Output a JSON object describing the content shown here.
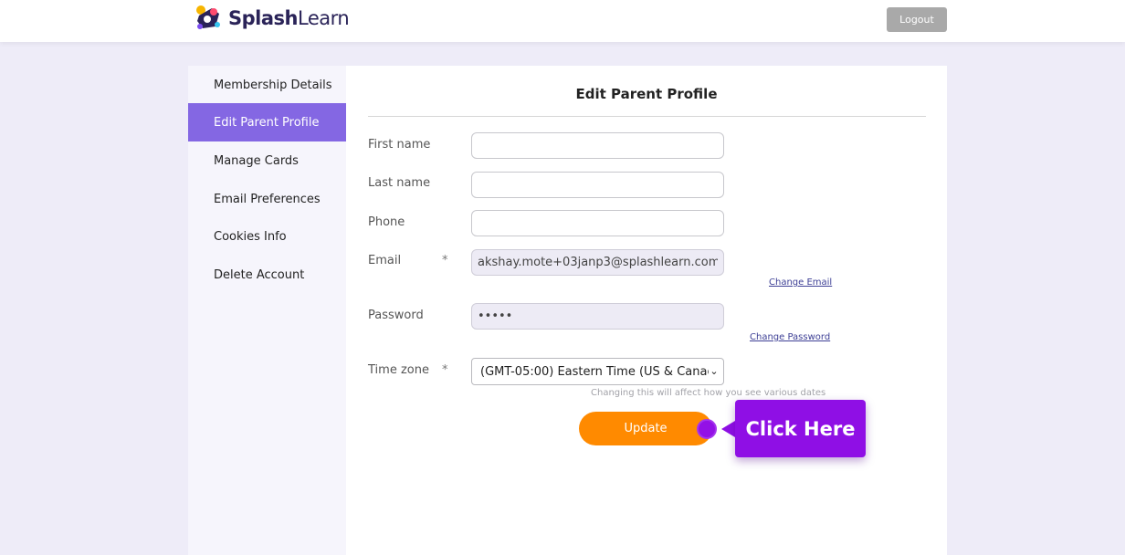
{
  "header": {
    "logo_text_bold": "Splash",
    "logo_text_light": "Learn",
    "logout_label": "Logout"
  },
  "sidebar": {
    "items": [
      {
        "label": "Membership Details",
        "active": false
      },
      {
        "label": "Edit Parent Profile",
        "active": true
      },
      {
        "label": "Manage Cards",
        "active": false
      },
      {
        "label": "Email Preferences",
        "active": false
      },
      {
        "label": "Cookies Info",
        "active": false
      },
      {
        "label": "Delete Account",
        "active": false
      }
    ]
  },
  "form": {
    "title": "Edit Parent Profile",
    "first_name": {
      "label": "First name",
      "value": ""
    },
    "last_name": {
      "label": "Last name",
      "value": ""
    },
    "phone": {
      "label": "Phone",
      "value": ""
    },
    "email": {
      "label": "Email",
      "required_mark": "*",
      "value": "akshay.mote+03janp3@splashlearn.com",
      "change_link": "Change Email"
    },
    "password": {
      "label": "Password",
      "value": "•••••",
      "change_link": "Change Password"
    },
    "timezone": {
      "label": "Time zone",
      "required_mark": "*",
      "value": "(GMT-05:00) Eastern Time (US & Canac",
      "hint": "Changing this will affect how you see various dates"
    },
    "update_label": "Update"
  },
  "callout": {
    "text": "Click Here"
  },
  "colors": {
    "accent_purple": "#8467e3",
    "update_orange": "#ff8a00",
    "callout_purple": "#8f0fe5",
    "logout_gray": "#a9a9a9"
  }
}
